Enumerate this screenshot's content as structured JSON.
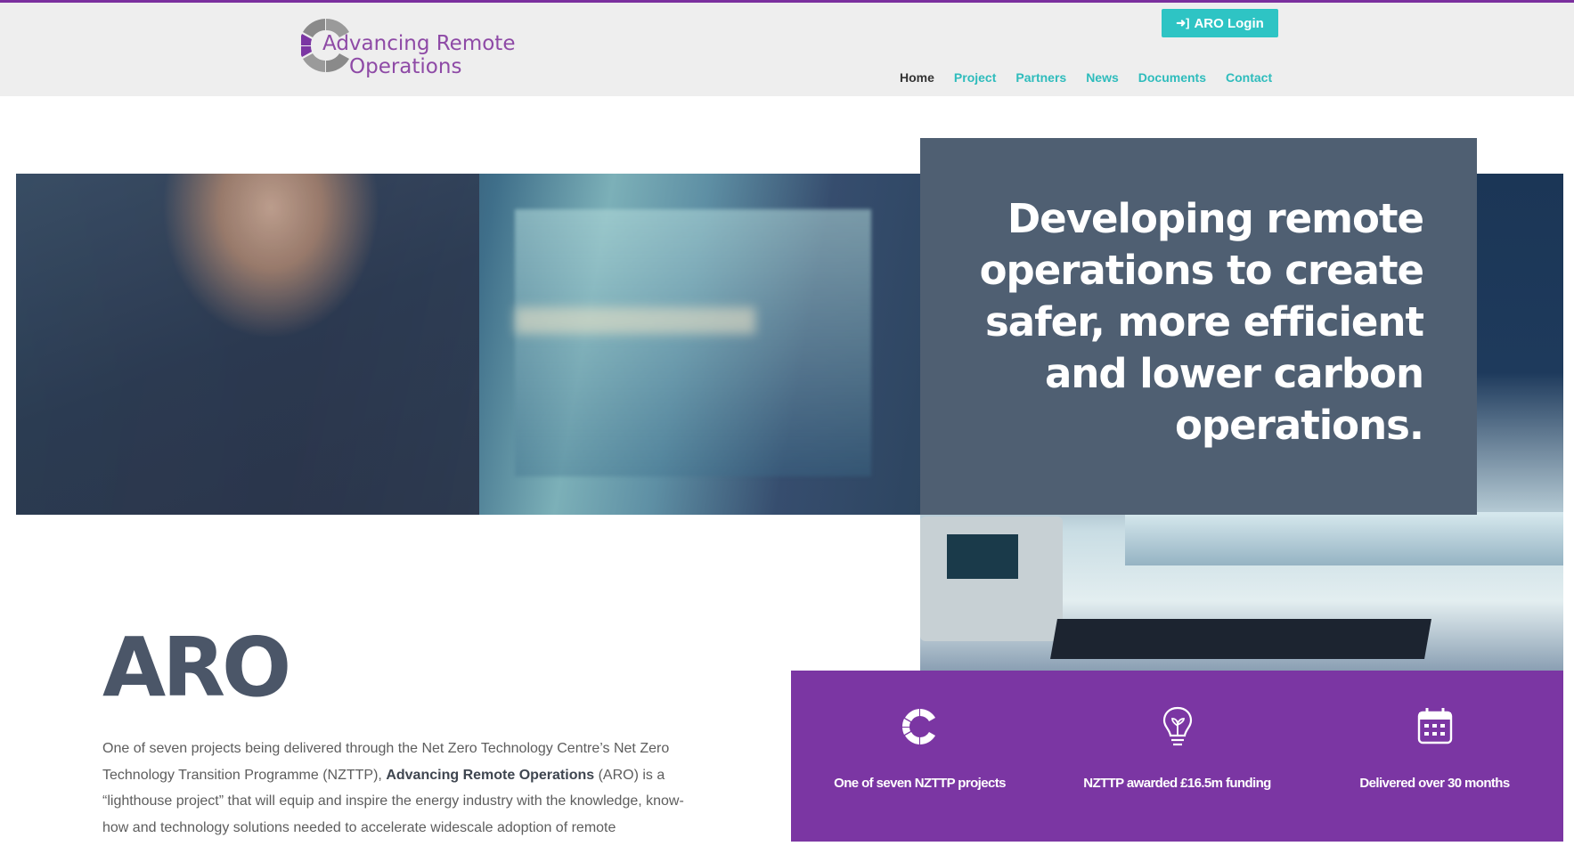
{
  "header": {
    "logo_line1": "Advancing Remote",
    "logo_line2": "Operations",
    "login_label": "ARO Login",
    "login_icon": "sign-in-icon",
    "nav": [
      {
        "label": "Home",
        "active": true
      },
      {
        "label": "Project",
        "active": false
      },
      {
        "label": "Partners",
        "active": false
      },
      {
        "label": "News",
        "active": false
      },
      {
        "label": "Documents",
        "active": false
      },
      {
        "label": "Contact",
        "active": false
      }
    ]
  },
  "hero": {
    "headline": "Developing remote operations to create safer, more efficient and lower carbon operations."
  },
  "stats": [
    {
      "icon": "aro-logo-icon",
      "label": "One of seven NZTTP projects"
    },
    {
      "icon": "lightbulb-icon",
      "label": "NZTTP awarded £16.5m funding"
    },
    {
      "icon": "calendar-icon",
      "label": "Delivered over 30 months"
    }
  ],
  "intro": {
    "title": "ARO",
    "text_before": "One of seven projects being delivered through the Net Zero Technology Centre’s Net Zero Technology Transition Programme (NZTTP), ",
    "text_bold": "Advancing Remote Operations",
    "text_after": " (ARO) is a “lighthouse project” that will equip and inspire the energy industry with the knowledge, know-how and technology solutions needed to accelerate widescale adoption of remote"
  },
  "colors": {
    "brand_purple": "#7b36a3",
    "accent_teal": "#2ec4c4",
    "slate": "#4f5f72"
  }
}
